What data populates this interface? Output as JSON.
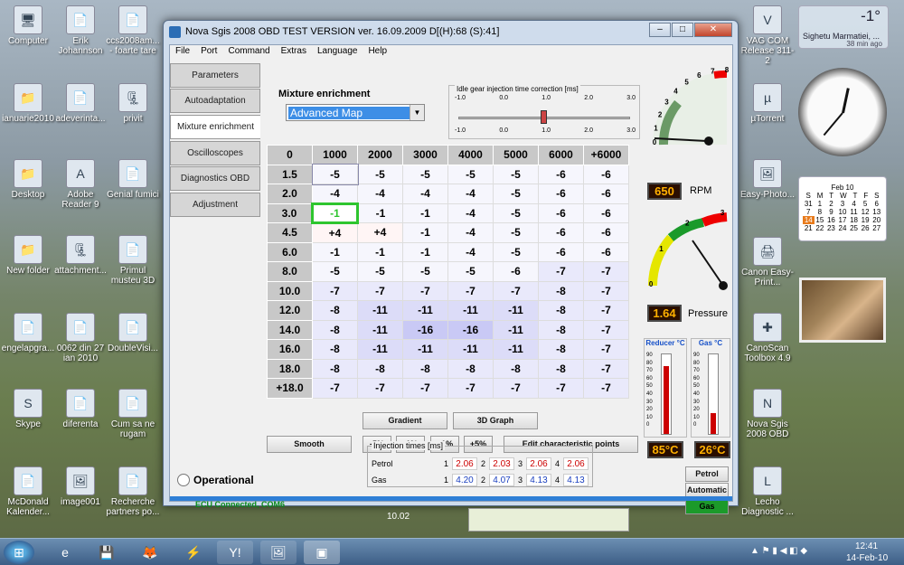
{
  "desktop": {
    "icons": [
      {
        "label": "Computer",
        "glyph": "🖥"
      },
      {
        "label": "Erik Johannson",
        "glyph": "📄"
      },
      {
        "label": "ccs2008am... - foarte tare",
        "glyph": "📄"
      },
      {
        "label": "ianuarie2010",
        "glyph": "📁"
      },
      {
        "label": "adeverinta...",
        "glyph": "📄"
      },
      {
        "label": "privit",
        "glyph": "🗜"
      },
      {
        "label": "Desktop",
        "glyph": "📁"
      },
      {
        "label": "Adobe Reader 9",
        "glyph": "A"
      },
      {
        "label": "Genial fumici",
        "glyph": "📄"
      },
      {
        "label": "New folder",
        "glyph": "📁"
      },
      {
        "label": "attachment...",
        "glyph": "🗜"
      },
      {
        "label": "Primul musteu 3D",
        "glyph": "📄"
      },
      {
        "label": "engelapgra...",
        "glyph": "📄"
      },
      {
        "label": "0062 din 27 ian 2010",
        "glyph": "📄"
      },
      {
        "label": "DoubleVisi...",
        "glyph": "📄"
      },
      {
        "label": "Skype",
        "glyph": "S"
      },
      {
        "label": "diferenta",
        "glyph": "📄"
      },
      {
        "label": "Cum sa ne rugam",
        "glyph": "📄"
      },
      {
        "label": "McDonald Kalender...",
        "glyph": "📄"
      },
      {
        "label": "image001",
        "glyph": "🖼"
      },
      {
        "label": "Recherche partners po...",
        "glyph": "📄"
      },
      {
        "label": "VAG COM Release 311-2",
        "glyph": "V"
      },
      {
        "label": "µTorrent",
        "glyph": "µ"
      },
      {
        "label": "Easy-Photo...",
        "glyph": "🖼"
      },
      {
        "label": "Canon Easy-Print...",
        "glyph": "🖨"
      },
      {
        "label": "CanoScan Toolbox 4.9",
        "glyph": "✚"
      },
      {
        "label": "Nova Sgis 2008 OBD",
        "glyph": "N"
      },
      {
        "label": "Lecho Diagnostic ...",
        "glyph": "L"
      }
    ],
    "weather": {
      "temp": "-1°",
      "location": "Sighetu Marmatiei, ...",
      "updated": "38 min ago"
    },
    "calendar": {
      "month": "Feb 10",
      "days_header": [
        "S",
        "M",
        "T",
        "W",
        "T",
        "F",
        "S"
      ],
      "today": "14"
    },
    "taskbar_misc": "10.02"
  },
  "window": {
    "title": "Nova Sgis 2008 OBD TEST VERSION ver. 16.09.2009 D[(H):68 (S):41]",
    "menu": [
      "File",
      "Port",
      "Command",
      "Extras",
      "Language",
      "Help"
    ],
    "tabs": [
      "Parameters",
      "Autoadaptation",
      "Mixture enrichment",
      "Oscilloscopes",
      "Diagnostics OBD",
      "Adjustment"
    ],
    "active_tab": "Mixture enrichment",
    "mixture": {
      "title": "Mixture enrichment",
      "selected": "Advanced Map"
    },
    "idle": {
      "title": "Idle gear injection time correction [ms]",
      "top_ticks": [
        "-1.0",
        "0.0",
        "1.0",
        "2.0",
        "3.0"
      ],
      "bottom_ticks": [
        "-1.0",
        "0.0",
        "1.0",
        "2.0",
        "3.0"
      ],
      "value_fraction": 0.5
    },
    "map": {
      "corner": "0",
      "columns": [
        "1000",
        "2000",
        "3000",
        "4000",
        "5000",
        "6000",
        "+6000"
      ],
      "rows": [
        {
          "label": "1.5",
          "values": [
            "-5",
            "-5",
            "-5",
            "-5",
            "-5",
            "-6",
            "-6"
          ]
        },
        {
          "label": "2.0",
          "values": [
            "-4",
            "-4",
            "-4",
            "-4",
            "-5",
            "-6",
            "-6"
          ]
        },
        {
          "label": "3.0",
          "values": [
            "-1",
            "-1",
            "-1",
            "-4",
            "-5",
            "-6",
            "-6"
          ]
        },
        {
          "label": "4.5",
          "values": [
            "+4",
            "+4",
            "-1",
            "-4",
            "-5",
            "-6",
            "-6"
          ]
        },
        {
          "label": "6.0",
          "values": [
            "-1",
            "-1",
            "-1",
            "-4",
            "-5",
            "-6",
            "-6"
          ]
        },
        {
          "label": "8.0",
          "values": [
            "-5",
            "-5",
            "-5",
            "-5",
            "-6",
            "-7",
            "-7"
          ]
        },
        {
          "label": "10.0",
          "values": [
            "-7",
            "-7",
            "-7",
            "-7",
            "-7",
            "-8",
            "-7"
          ]
        },
        {
          "label": "12.0",
          "values": [
            "-8",
            "-11",
            "-11",
            "-11",
            "-11",
            "-8",
            "-7"
          ]
        },
        {
          "label": "14.0",
          "values": [
            "-8",
            "-11",
            "-16",
            "-16",
            "-11",
            "-8",
            "-7"
          ]
        },
        {
          "label": "16.0",
          "values": [
            "-8",
            "-11",
            "-11",
            "-11",
            "-11",
            "-8",
            "-7"
          ]
        },
        {
          "label": "18.0",
          "values": [
            "-8",
            "-8",
            "-8",
            "-8",
            "-8",
            "-8",
            "-7"
          ]
        },
        {
          "label": "+18.0",
          "values": [
            "-7",
            "-7",
            "-7",
            "-7",
            "-7",
            "-7",
            "-7"
          ]
        }
      ]
    },
    "buttons": {
      "gradient": "Gradient",
      "graph3d": "3D Graph",
      "smooth": "Smooth",
      "m5": "-5%",
      "m1": "-1%",
      "p1": "+1%",
      "p5": "+5%",
      "edit": "Edit characteristic points",
      "petrol": "Petrol",
      "automatic": "Automatic",
      "gas": "Gas"
    },
    "status": {
      "operational": "Operational",
      "connection": "ECU Connected, COM6"
    },
    "injection": {
      "title": "Injection times [ms]",
      "petrol_label": "Petrol",
      "gas_label": "Gas",
      "petrol": [
        "2.06",
        "2.03",
        "2.06",
        "2.06"
      ],
      "gas": [
        "4.20",
        "4.07",
        "4.13",
        "4.13"
      ],
      "cyl": [
        "1",
        "2",
        "3",
        "4"
      ]
    },
    "rpm": {
      "value": "650",
      "label": "RPM",
      "ticks": [
        "0",
        "1",
        "2",
        "3",
        "4",
        "5",
        "6",
        "7",
        "8"
      ]
    },
    "pressure": {
      "value": "1.64",
      "label": "Pressure",
      "ticks": [
        "0",
        "1",
        "2",
        "3"
      ]
    },
    "reducer": {
      "title": "Reducer °C",
      "value": "85°C",
      "ticks": [
        "90",
        "80",
        "70",
        "60",
        "50",
        "40",
        "30",
        "20",
        "10",
        "0"
      ],
      "level": 0.85
    },
    "gasTemp": {
      "title": "Gas °C",
      "value": "26°C",
      "ticks": [
        "90",
        "80",
        "70",
        "60",
        "50",
        "40",
        "30",
        "20",
        "10",
        "0"
      ],
      "level": 0.26
    }
  },
  "taskbar": {
    "time": "12:41",
    "date": "14-Feb-10"
  }
}
